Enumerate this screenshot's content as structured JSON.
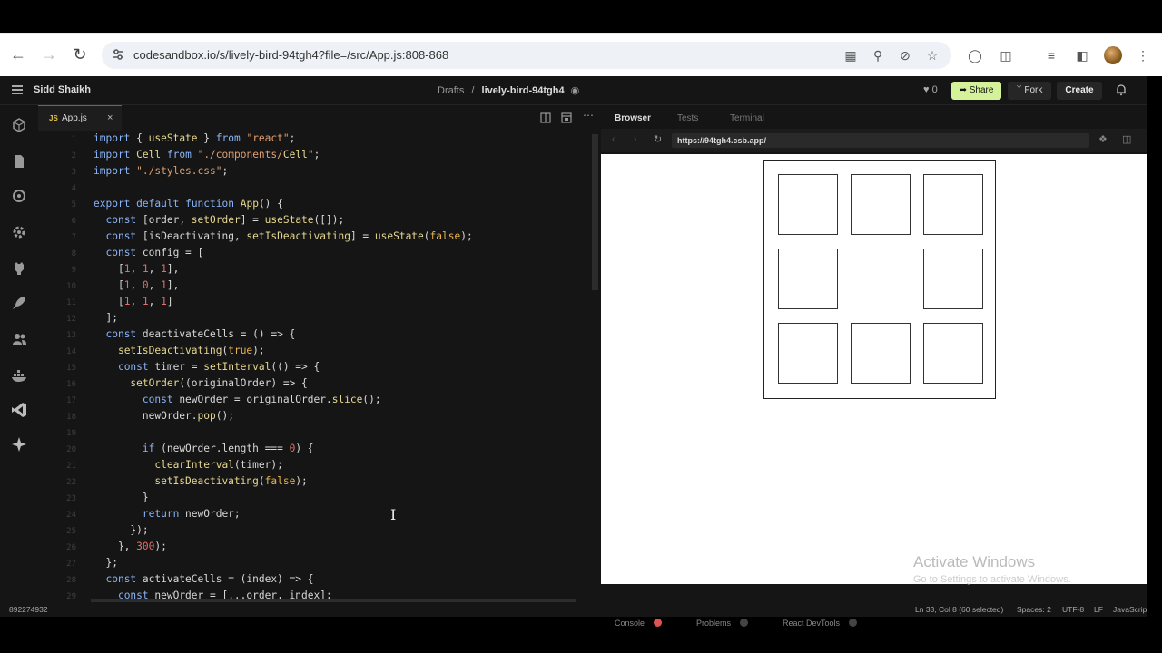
{
  "browser": {
    "url": "codesandbox.io/s/lively-bird-94tgh4?file=/src/App.js:808-868"
  },
  "topbar": {
    "user": "Sidd Shaikh",
    "crumb_parent": "Drafts",
    "crumb_sep": "/",
    "crumb_name": "lively-bird-94tgh4",
    "likes": "0",
    "share": "Share",
    "fork": "Fork",
    "create": "Create"
  },
  "editor": {
    "tab_label": "App.js",
    "tab_badge": "JS",
    "tab_close": "×",
    "lines": [
      {
        "n": "1",
        "t": "import { useState } from \"react\";"
      },
      {
        "n": "2",
        "t": "import Cell from \"./components/Cell\";"
      },
      {
        "n": "3",
        "t": "import \"./styles.css\";"
      },
      {
        "n": "4",
        "t": ""
      },
      {
        "n": "5",
        "t": "export default function App() {"
      },
      {
        "n": "6",
        "t": "  const [order, setOrder] = useState([]);"
      },
      {
        "n": "7",
        "t": "  const [isDeactivating, setIsDeactivating] = useState(false);"
      },
      {
        "n": "8",
        "t": "  const config = ["
      },
      {
        "n": "9",
        "t": "    [1, 1, 1],"
      },
      {
        "n": "10",
        "t": "    [1, 0, 1],"
      },
      {
        "n": "11",
        "t": "    [1, 1, 1]"
      },
      {
        "n": "12",
        "t": "  ];"
      },
      {
        "n": "13",
        "t": "  const deactivateCells = () => {"
      },
      {
        "n": "14",
        "t": "    setIsDeactivating(true);"
      },
      {
        "n": "15",
        "t": "    const timer = setInterval(() => {"
      },
      {
        "n": "16",
        "t": "      setOrder((originalOrder) => {"
      },
      {
        "n": "17",
        "t": "        const newOrder = originalOrder.slice();"
      },
      {
        "n": "18",
        "t": "        newOrder.pop();"
      },
      {
        "n": "19",
        "t": ""
      },
      {
        "n": "20",
        "t": "        if (newOrder.length === 0) {"
      },
      {
        "n": "21",
        "t": "          clearInterval(timer);"
      },
      {
        "n": "22",
        "t": "          setIsDeactivating(false);"
      },
      {
        "n": "23",
        "t": "        }"
      },
      {
        "n": "24",
        "t": "        return newOrder;"
      },
      {
        "n": "25",
        "t": "      });"
      },
      {
        "n": "26",
        "t": "    }, 300);"
      },
      {
        "n": "27",
        "t": "  };"
      },
      {
        "n": "28",
        "t": "  const activateCells = (index) => {"
      },
      {
        "n": "29",
        "t": "    const newOrder = [...order, index];"
      }
    ]
  },
  "preview": {
    "tabs": [
      "Browser",
      "Tests",
      "Terminal"
    ],
    "url": "https://94tgh4.csb.app/",
    "config": [
      [
        1,
        1,
        1
      ],
      [
        1,
        0,
        1
      ],
      [
        1,
        1,
        1
      ]
    ],
    "watermark_title": "Activate Windows",
    "watermark_sub": "Go to Settings to activate Windows.",
    "bottom_tabs": [
      "Console",
      "Problems",
      "React DevTools"
    ]
  },
  "status": {
    "left": "892274932",
    "position": "Ln 33, Col 8 (60 selected)",
    "spaces": "Spaces: 2",
    "encoding": "UTF-8",
    "eol": "LF",
    "language": "JavaScript"
  },
  "colors": {
    "share_bg": "#d4f29a",
    "console_badge": "#e05252"
  }
}
